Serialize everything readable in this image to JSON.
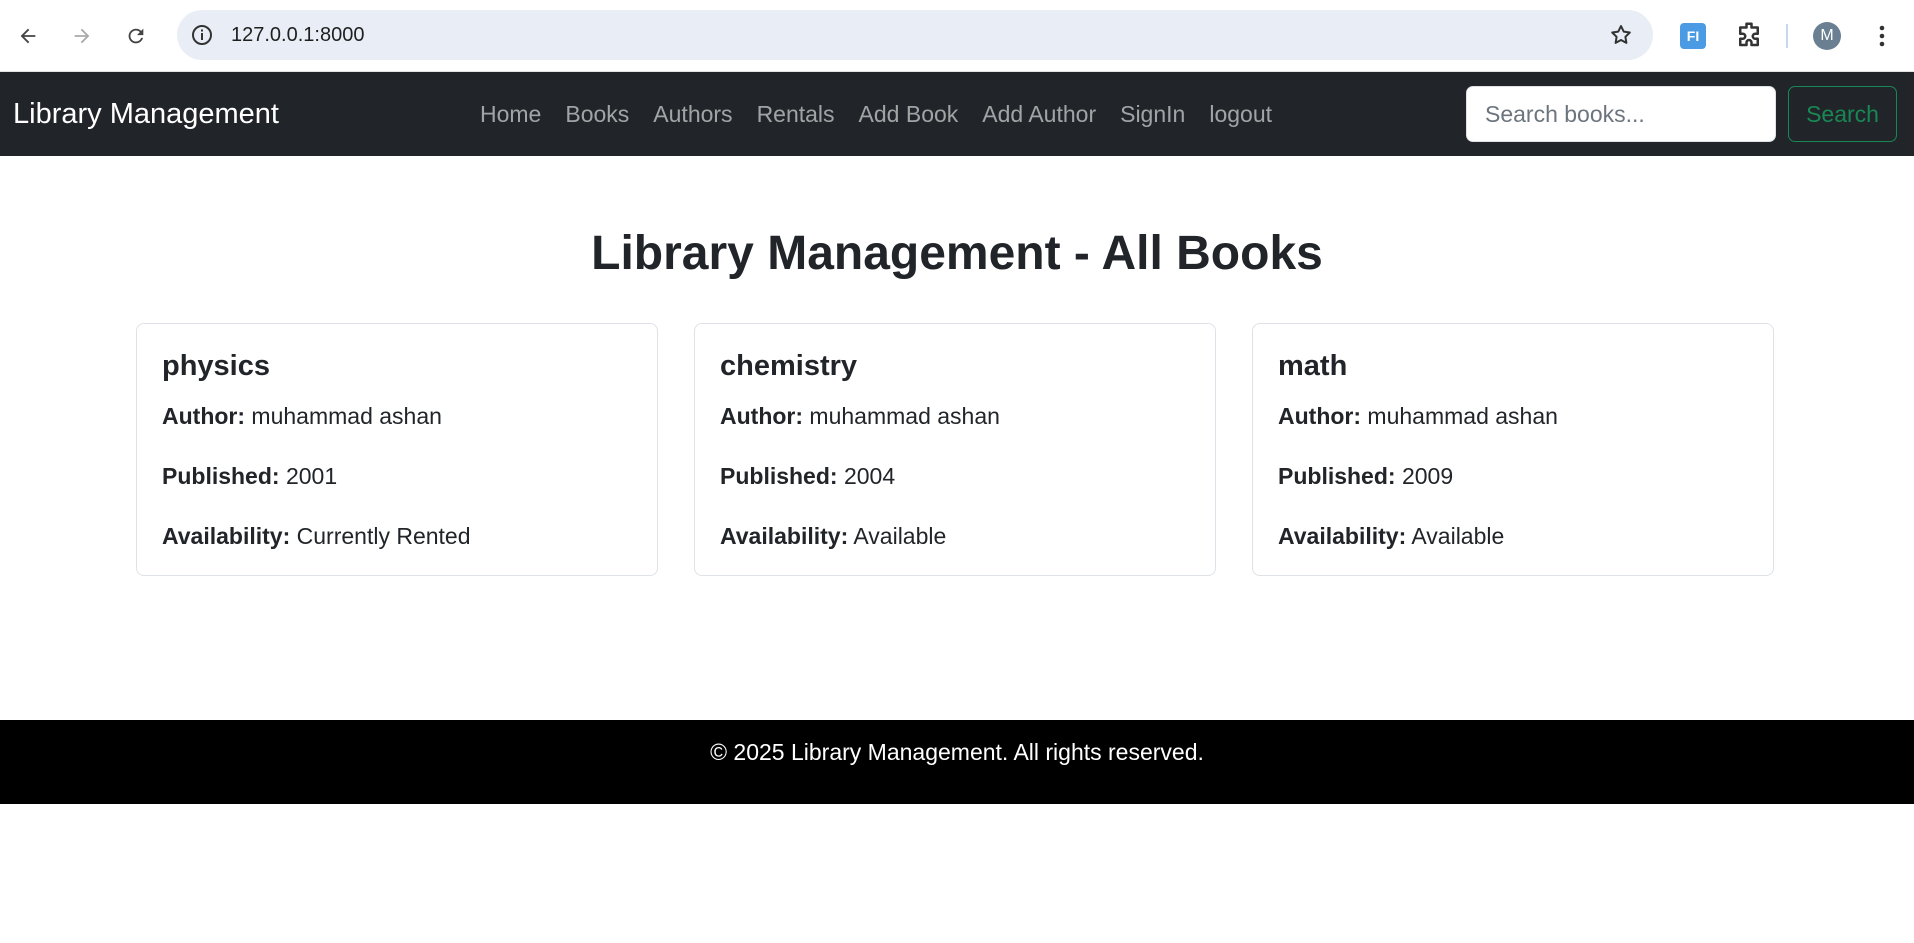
{
  "browser": {
    "url": "127.0.0.1:8000",
    "extension_label": "FI",
    "profile_initial": "M",
    "icons": [
      "back-arrow-icon",
      "forward-arrow-icon",
      "reload-icon",
      "info-icon",
      "star-icon",
      "puzzle-icon",
      "kebab-menu-icon"
    ]
  },
  "navbar": {
    "brand": "Library Management",
    "links": [
      "Home",
      "Books",
      "Authors",
      "Rentals",
      "Add Book",
      "Add Author",
      "SignIn",
      "logout"
    ],
    "search_placeholder": "Search books...",
    "search_button": "Search"
  },
  "main": {
    "title": "Library Management - All Books",
    "labels": {
      "author": "Author:",
      "published": "Published:",
      "availability": "Availability:"
    },
    "books": [
      {
        "title": "physics",
        "author": "muhammad ashan",
        "published": "2001",
        "availability": "Currently Rented"
      },
      {
        "title": "chemistry",
        "author": "muhammad ashan",
        "published": "2004",
        "availability": "Available"
      },
      {
        "title": "math",
        "author": "muhammad ashan",
        "published": "2009",
        "availability": "Available"
      }
    ]
  },
  "footer": {
    "text": "© 2025 Library Management. All rights reserved."
  },
  "colors": {
    "navbar_bg": "#212529",
    "footer_bg": "#000000",
    "search_button": "#198754",
    "omnibox_bg": "#e9eef6"
  }
}
